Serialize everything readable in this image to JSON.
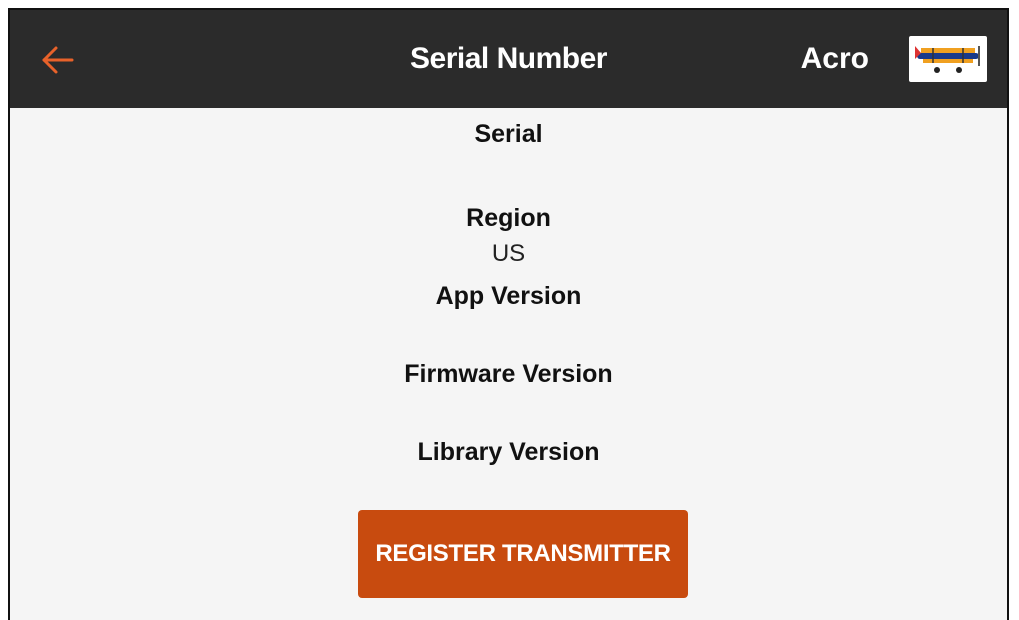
{
  "header": {
    "title": "Serial Number",
    "model_name": "Acro",
    "back_icon": "arrow-left-icon",
    "model_image_icon": "airplane-thumbnail-icon",
    "accent_color": "#e8622a"
  },
  "info": {
    "serial_label": "Serial",
    "region_label": "Region",
    "region_value": "US",
    "app_version_label": "App Version",
    "firmware_version_label": "Firmware Version",
    "library_version_label": "Library Version"
  },
  "actions": {
    "register_label": "REGISTER TRANSMITTER",
    "register_color": "#c84b0f"
  }
}
